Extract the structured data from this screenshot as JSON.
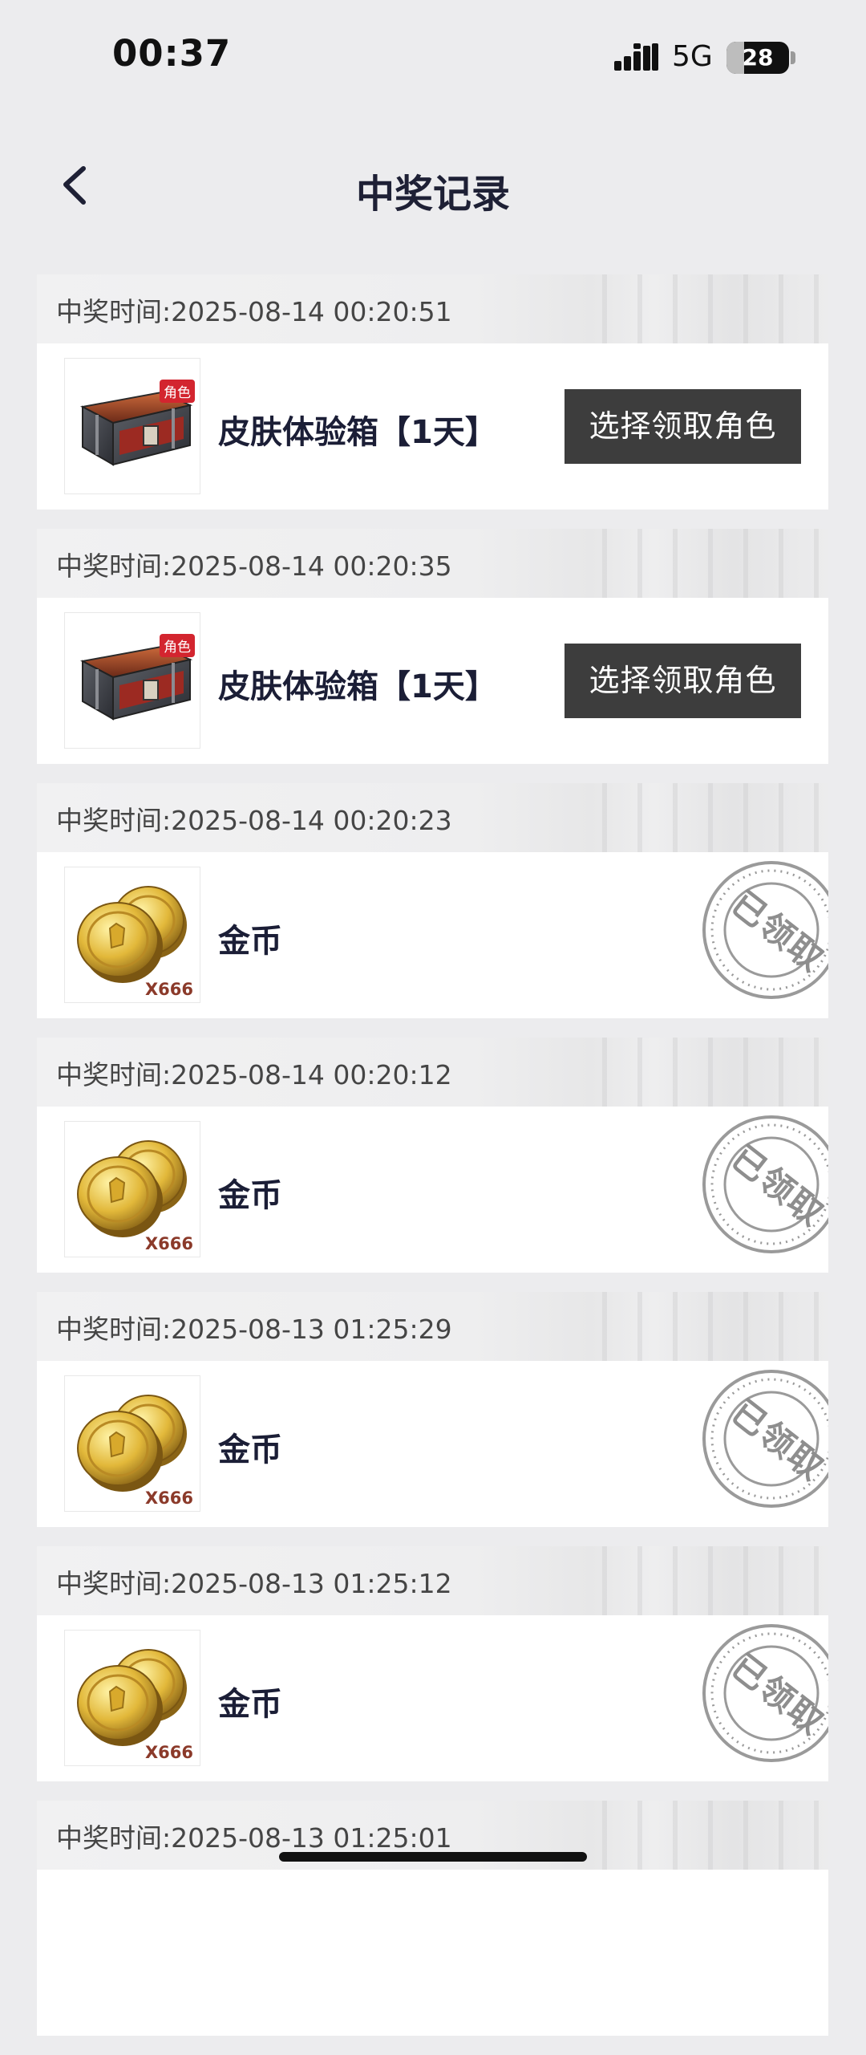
{
  "status_bar": {
    "time": "00:37",
    "network": "5G",
    "battery": "28",
    "battery_level": 0.28
  },
  "header": {
    "title": "中奖记录"
  },
  "records": [
    {
      "time": "中奖时间:2025-08-14 00:20:51",
      "prize": "皮肤体验箱【1天】",
      "icon": "chest-icon",
      "badge": "角色",
      "action": "选择领取角色"
    },
    {
      "time": "中奖时间:2025-08-14 00:20:35",
      "prize": "皮肤体验箱【1天】",
      "icon": "chest-icon",
      "badge": "角色",
      "action": "选择领取角色"
    },
    {
      "time": "中奖时间:2025-08-14 00:20:23",
      "prize": "金币",
      "icon": "coins-icon",
      "qty": "X666",
      "stamp": "已领取"
    },
    {
      "time": "中奖时间:2025-08-14 00:20:12",
      "prize": "金币",
      "icon": "coins-icon",
      "qty": "X666",
      "stamp": "已领取"
    },
    {
      "time": "中奖时间:2025-08-13 01:25:29",
      "prize": "金币",
      "icon": "coins-icon",
      "qty": "X666",
      "stamp": "已领取"
    },
    {
      "time": "中奖时间:2025-08-13 01:25:12",
      "prize": "金币",
      "icon": "coins-icon",
      "qty": "X666",
      "stamp": "已领取"
    },
    {
      "time": "中奖时间:2025-08-13 01:25:01"
    }
  ],
  "colors": {
    "background": "#ececee",
    "button": "#3d3d3d",
    "title": "#1e2035",
    "badge": "#d3252f"
  }
}
